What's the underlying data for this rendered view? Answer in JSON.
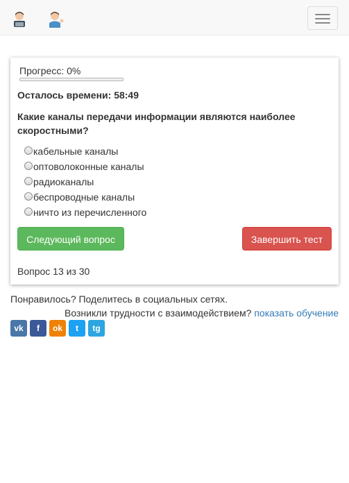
{
  "nav": {
    "avatar1_icon": "man-technologist-icon",
    "avatar2_icon": "man-tipping-hand-icon",
    "menu_icon": "hamburger-menu-icon"
  },
  "quiz": {
    "progress_label": "Прогресс: 0%",
    "progress_fraction": 0.0,
    "timer_label": "Осталось времени: 58:49",
    "question": "Какие каналы передачи информации являются наиболее скоростными?",
    "answers": [
      "кабельные каналы",
      "оптоволоконные каналы",
      "радиоканалы",
      "беспроводные каналы",
      "ничто из перечисленного"
    ],
    "next_button": "Следующий вопрос",
    "finish_button": "Завершить тест",
    "counter": "Вопрос 13 из 30"
  },
  "footer": {
    "share_text": "Понравилось? Поделитесь в социальных сетях.",
    "help_text": "Возникли трудности с взаимодействием? ",
    "help_link": "показать обучение"
  },
  "socials": [
    {
      "name": "vk",
      "glyph": "vk",
      "color": "#4a76a8"
    },
    {
      "name": "facebook",
      "glyph": "f",
      "color": "#3b5998"
    },
    {
      "name": "odnoklassniki",
      "glyph": "ok",
      "color": "#ee8208"
    },
    {
      "name": "twitter",
      "glyph": "t",
      "color": "#1da1f2"
    },
    {
      "name": "telegram",
      "glyph": "tg",
      "color": "#2ca5e0"
    }
  ],
  "colors": {
    "success": "#5cb85c",
    "danger": "#d9534f",
    "link": "#337ab7"
  }
}
